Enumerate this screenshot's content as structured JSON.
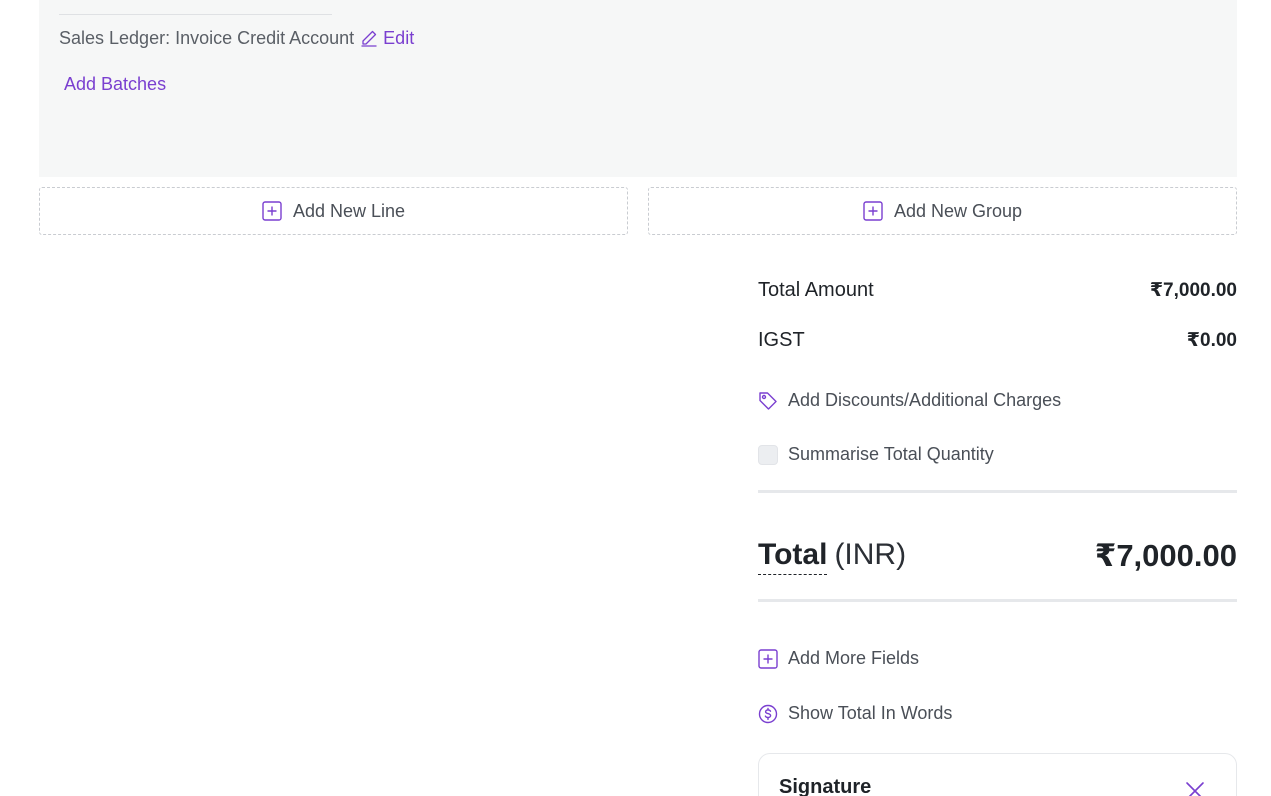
{
  "item_panel": {
    "ledger_label": "Sales Ledger: Invoice Credit Account",
    "edit_label": "Edit",
    "add_batches_label": "Add Batches"
  },
  "actions": {
    "add_new_line": "Add New Line",
    "add_new_group": "Add New Group"
  },
  "summary": {
    "total_amount_label": "Total Amount",
    "total_amount_value": "₹7,000.00",
    "igst_label": "IGST",
    "igst_value": "₹0.00",
    "add_discounts_label": "Add Discounts/Additional Charges",
    "summarise_label": "Summarise Total Quantity",
    "total_label": "Total",
    "total_currency": "(INR)",
    "total_value": "₹7,000.00",
    "add_more_fields_label": "Add More Fields",
    "show_total_words_label": "Show Total In Words"
  },
  "signature": {
    "title": "Signature"
  },
  "colors": {
    "accent": "#7a3fd0",
    "panel_bg": "#f6f7f7"
  }
}
